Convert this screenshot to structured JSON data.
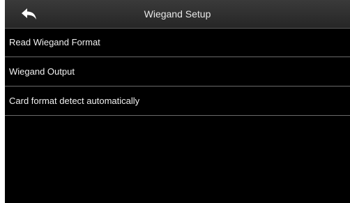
{
  "header": {
    "title": "Wiegand Setup",
    "back_icon": "back-arrow-icon"
  },
  "menu": {
    "items": [
      {
        "label": "Read Wiegand Format"
      },
      {
        "label": "Wiegand Output"
      },
      {
        "label": "Card format detect automatically"
      }
    ]
  },
  "colors": {
    "background": "#000000",
    "header": "#2f2f2f",
    "text": "#f0f0f0",
    "divider": "#6a6a6a"
  }
}
